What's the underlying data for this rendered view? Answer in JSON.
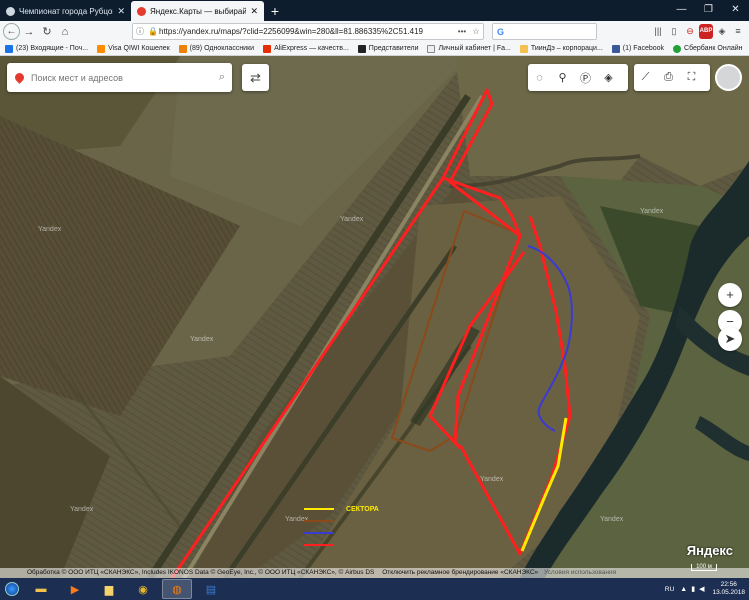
{
  "tabs": [
    {
      "title": "Чемпионат города Рубцовска по",
      "favicon_color": "#e6e6e6",
      "active": false
    },
    {
      "title": "Яндекс.Карты — выбирайте, гд",
      "favicon_color": "#e53a2f",
      "active": true
    }
  ],
  "newtab_label": "+",
  "window_controls": {
    "minimize": "—",
    "restore": "❐",
    "close": "✕"
  },
  "nav": {
    "url": "https://yandex.ru/maps/?clid=2256099&win=280&ll=81.886335%2C51.419",
    "search_engine": "G",
    "search_placeholder": ""
  },
  "bookmarks": [
    {
      "label": "(23) Входящие - Поч...",
      "color": "#1a73e8"
    },
    {
      "label": "Visa QIWI Кошелек",
      "color": "#ff8c00"
    },
    {
      "label": "(89) Одноклассники",
      "color": "#ee8208"
    },
    {
      "label": "AliExpress — качеств...",
      "color": "#e62e04"
    },
    {
      "label": "Представители",
      "color": "#222222"
    },
    {
      "label": "Личный кабинет | Fa...",
      "color": "#444444"
    },
    {
      "label": "ТиинДэ – корпораци...",
      "color": "#c8a000"
    },
    {
      "label": "(1) Facebook",
      "color": "#3b5998"
    },
    {
      "label": "Сбербанк Онлайн",
      "color": "#21a038"
    }
  ],
  "map": {
    "search_placeholder": "Поиск мест и адресов",
    "watermark": "Yandex",
    "legend": [
      {
        "label": "СЕКТОРА",
        "color": "#ffea00"
      },
      {
        "label": "",
        "color": "#8a4a1a"
      },
      {
        "label": "",
        "color": "#3b3bd4"
      },
      {
        "label": "",
        "color": "#ff2020"
      }
    ],
    "logo": "Яндекс",
    "scale_label": "100 м",
    "copyright": "Обработка © ООО ИТЦ «СКАНЭКС», Includes IKONOS Data © GeoEye, Inc., © ООО ИТЦ «СКАНЭКС», © Airbus DS",
    "ad_link": "Отключить рекламное брендирование «СКАНЭКС»",
    "terms_link": "Условия использования"
  },
  "taskbar": {
    "lang": "RU",
    "time": "22:56",
    "date": "13.05.2018"
  }
}
